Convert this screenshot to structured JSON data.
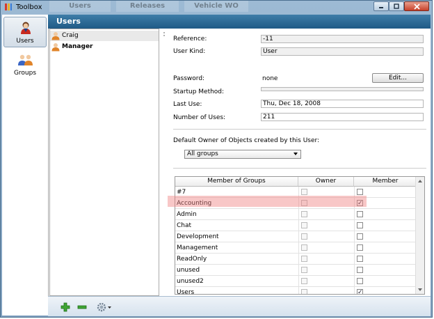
{
  "window": {
    "title": "Toolbox",
    "background_tabs": [
      "Users",
      "Releases",
      "Vehicle WO"
    ]
  },
  "nav": {
    "items": [
      {
        "label": "Users",
        "icon": "user-icon",
        "selected": true
      },
      {
        "label": "Groups",
        "icon": "users-group-icon",
        "selected": false
      }
    ]
  },
  "header": {
    "title": "Users"
  },
  "users": [
    {
      "name": "Craig",
      "selected": true
    },
    {
      "name": "Manager",
      "selected": false
    }
  ],
  "detail": {
    "reference_label": "Reference:",
    "reference_value": "-11",
    "user_kind_label": "User Kind:",
    "user_kind_value": "User",
    "password_label": "Password:",
    "password_value": "none",
    "edit_button": "Edit...",
    "startup_label": "Startup Method:",
    "startup_value": "",
    "last_use_label": "Last Use:",
    "last_use_value": "Thu, Dec 18, 2008",
    "uses_label": "Number of Uses:",
    "uses_value": "211",
    "default_owner_label": "Default Owner of Objects created by this User:",
    "default_owner_value": "All groups"
  },
  "groups_table": {
    "headers": [
      "Member of Groups",
      "Owner",
      "Member"
    ],
    "rows": [
      {
        "name": "#7",
        "owner": false,
        "member": false
      },
      {
        "name": "Accounting",
        "owner": false,
        "member": true
      },
      {
        "name": "Admin",
        "owner": false,
        "member": false
      },
      {
        "name": "Chat",
        "owner": false,
        "member": false
      },
      {
        "name": "Development",
        "owner": false,
        "member": false
      },
      {
        "name": "Management",
        "owner": false,
        "member": false
      },
      {
        "name": "ReadOnly",
        "owner": false,
        "member": false
      },
      {
        "name": "unused",
        "owner": false,
        "member": false
      },
      {
        "name": "unused2",
        "owner": false,
        "member": false
      },
      {
        "name": "Users",
        "owner": false,
        "member": true
      }
    ]
  },
  "toolbar": {
    "icons": [
      "add-icon",
      "remove-icon",
      "gear-icon"
    ]
  },
  "colors": {
    "header": "#2c6a96",
    "highlight": "#f08282"
  }
}
